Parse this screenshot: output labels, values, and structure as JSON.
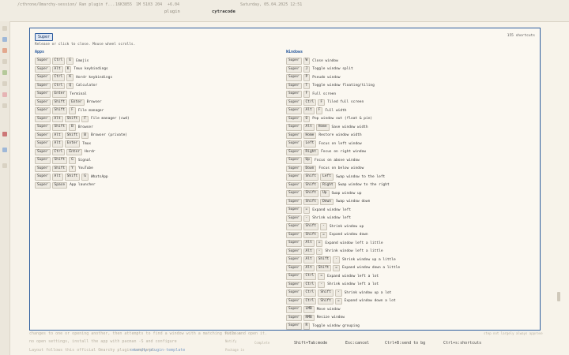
{
  "topbar": {
    "path": "/cthrone/Omarchy-session/ Ran plugin f...",
    "mem": "16K3855",
    "stat": "1M 5103 204",
    "temp": "+6.04",
    "date": "Saturday, 05.04.2025 12:51",
    "tabs": [
      "plugin",
      "cytracode"
    ]
  },
  "background": {
    "line1": "changes to one or opening another, then attempts to find a window with a matching title and open it.",
    "line2": "Layout follows this official Omarchy plugin template:",
    "link": "omarchy-plugin-template",
    "line3": "Follow the Omarchy plugin template description",
    "line4": "no open settings, install the app with pacman -S and configure",
    "field1": "Position",
    "field2": "Notify",
    "field3": "Package in",
    "complete": "Complete",
    "right_note": "step not largely     always approve"
  },
  "overlay": {
    "badge": "Super",
    "count": "155 shortcuts",
    "hint": "Release or click to close. Mouse wheel scrolls.",
    "apps_title": "Apps",
    "windows_title": "Windows",
    "apps": [
      {
        "keys": [
          "Super",
          "Ctrl",
          "E"
        ],
        "desc": "Emojis"
      },
      {
        "keys": [
          "Super",
          "Alt",
          "K"
        ],
        "desc": "Tmux keybindings"
      },
      {
        "keys": [
          "Super",
          "Ctrl",
          "K"
        ],
        "desc": "Hordr keybindings"
      },
      {
        "keys": [
          "Super",
          "Ctrl",
          "Q"
        ],
        "desc": "Calculator"
      },
      {
        "keys": [
          "Super",
          "Enter"
        ],
        "desc": "Terminal"
      },
      {
        "keys": [
          "Super",
          "Shift",
          "Enter"
        ],
        "desc": "Browser"
      },
      {
        "keys": [
          "Super",
          "Shift",
          "F"
        ],
        "desc": "File manager"
      },
      {
        "keys": [
          "Super",
          "Alt",
          "Shift",
          "F"
        ],
        "desc": "File manager (cwd)"
      },
      {
        "keys": [
          "Super",
          "Shift",
          "B"
        ],
        "desc": "Browser"
      },
      {
        "keys": [
          "Super",
          "Alt",
          "Shift",
          "B"
        ],
        "desc": "Browser (private)"
      },
      {
        "keys": [
          "Super",
          "Alt",
          "Enter"
        ],
        "desc": "Tmux"
      },
      {
        "keys": [
          "Super",
          "Ctrl",
          "Enter"
        ],
        "desc": "Hordr"
      },
      {
        "keys": [
          "Super",
          "Shift",
          "G"
        ],
        "desc": "Signal"
      },
      {
        "keys": [
          "Super",
          "Shift",
          "Y"
        ],
        "desc": "YouTube"
      },
      {
        "keys": [
          "Super",
          "Alt",
          "Shift",
          "G"
        ],
        "desc": "WhatsApp"
      },
      {
        "keys": [
          "Super",
          "Space"
        ],
        "desc": "App launcher"
      }
    ],
    "windows": [
      {
        "keys": [
          "Super",
          "W"
        ],
        "desc": "Close window"
      },
      {
        "keys": [
          "Super",
          "J"
        ],
        "desc": "Toggle window split"
      },
      {
        "keys": [
          "Super",
          "P"
        ],
        "desc": "Pseudo window"
      },
      {
        "keys": [
          "Super",
          "T"
        ],
        "desc": "Toggle window floating/tiling"
      },
      {
        "keys": [
          "Super",
          "F"
        ],
        "desc": "Full screen"
      },
      {
        "keys": [
          "Super",
          "Ctrl",
          "F"
        ],
        "desc": "Tiled full screen"
      },
      {
        "keys": [
          "Super",
          "Alt",
          "F"
        ],
        "desc": "Full width"
      },
      {
        "keys": [
          "Super",
          "O"
        ],
        "desc": "Pop window out (float & pin)"
      },
      {
        "keys": [
          "Super",
          "Alt",
          "Home"
        ],
        "desc": "Save window width"
      },
      {
        "keys": [
          "Super",
          "Home"
        ],
        "desc": "Restore window width"
      },
      {
        "keys": [
          "Super",
          "Left"
        ],
        "desc": "Focus on left window"
      },
      {
        "keys": [
          "Super",
          "Right"
        ],
        "desc": "Focus on right window"
      },
      {
        "keys": [
          "Super",
          "Up"
        ],
        "desc": "Focus on above window"
      },
      {
        "keys": [
          "Super",
          "Down"
        ],
        "desc": "Focus on below window"
      },
      {
        "keys": [
          "Super",
          "Shift",
          "Left"
        ],
        "desc": "Swap window to the left"
      },
      {
        "keys": [
          "Super",
          "Shift",
          "Right"
        ],
        "desc": "Swap window to the right"
      },
      {
        "keys": [
          "Super",
          "Shift",
          "Up"
        ],
        "desc": "Swap window up"
      },
      {
        "keys": [
          "Super",
          "Shift",
          "Down"
        ],
        "desc": "Swap window down"
      },
      {
        "keys": [
          "Super",
          "="
        ],
        "desc": "Expand window left"
      },
      {
        "keys": [
          "Super",
          "-"
        ],
        "desc": "Shrink window left"
      },
      {
        "keys": [
          "Super",
          "Shift",
          "-"
        ],
        "desc": "Shrink window up"
      },
      {
        "keys": [
          "Super",
          "Shift",
          "="
        ],
        "desc": "Expand window down"
      },
      {
        "keys": [
          "Super",
          "Alt",
          "="
        ],
        "desc": "Expand window left a little"
      },
      {
        "keys": [
          "Super",
          "Alt",
          "-"
        ],
        "desc": "Shrink window left a little"
      },
      {
        "keys": [
          "Super",
          "Alt",
          "Shift",
          "-"
        ],
        "desc": "Shrink window up a little"
      },
      {
        "keys": [
          "Super",
          "Alt",
          "Shift",
          "="
        ],
        "desc": "Expand window down a little"
      },
      {
        "keys": [
          "Super",
          "Ctrl",
          "="
        ],
        "desc": "Expand window left a lot"
      },
      {
        "keys": [
          "Super",
          "Ctrl",
          "-"
        ],
        "desc": "Shrink window left a lot"
      },
      {
        "keys": [
          "Super",
          "Ctrl",
          "Shift",
          "-"
        ],
        "desc": "Shrink window up a lot"
      },
      {
        "keys": [
          "Super",
          "Ctrl",
          "Shift",
          "="
        ],
        "desc": "Expand window down a lot"
      },
      {
        "keys": [
          "Super",
          "LMB"
        ],
        "desc": "Move window"
      },
      {
        "keys": [
          "Super",
          "RMB"
        ],
        "desc": "Resize window"
      },
      {
        "keys": [
          "Super",
          "R"
        ],
        "desc": "Toggle window grouping"
      }
    ]
  },
  "statusbar": {
    "items": [
      "Shift+Tab:mode",
      "Esc:cancel",
      "Ctrl+B:send to bg",
      "Ctrl+s:shortcuts"
    ]
  },
  "colors": {
    "accent": "#2e5d9e",
    "background": "#f7f3ea",
    "key_bg": "#eeeae1"
  }
}
